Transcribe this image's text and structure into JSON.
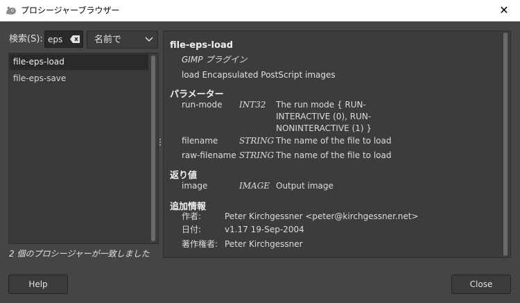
{
  "window": {
    "title": "プロシージャーブラウザー",
    "icon": "gimp-wilber-icon",
    "close_glyph": "✕"
  },
  "search": {
    "label": "検索(S):",
    "value": "eps",
    "match_mode": "名前で"
  },
  "procedures": [
    {
      "name": "file-eps-load",
      "selected": true
    },
    {
      "name": "file-eps-save",
      "selected": false
    }
  ],
  "match_count": "2 個のプロシージャーが一致しました",
  "details": {
    "name": "file-eps-load",
    "type": "GIMP プラグイン",
    "blurb": "load Encapsulated PostScript images",
    "params_heading": "パラメーター",
    "params": [
      {
        "name": "run-mode",
        "type": "INT32",
        "desc": "The run mode { RUN-INTERACTIVE (0), RUN-NONINTERACTIVE (1) }"
      },
      {
        "name": "filename",
        "type": "STRING",
        "desc": "The name of the file to load"
      },
      {
        "name": "raw-filename",
        "type": "STRING",
        "desc": "The name of the file to load"
      }
    ],
    "returns_heading": "返り値",
    "returns": [
      {
        "name": "image",
        "type": "IMAGE",
        "desc": "Output image"
      }
    ],
    "info_heading": "追加情報",
    "info": [
      {
        "label": "作者:",
        "value": "Peter Kirchgessner <peter@kirchgessner.net>"
      },
      {
        "label": "日付:",
        "value": "v1.17  19-Sep-2004"
      },
      {
        "label": "著作権者:",
        "value": "Peter Kirchgessner"
      }
    ]
  },
  "buttons": {
    "help": "Help",
    "close": "Close"
  },
  "colors": {
    "background": "#454545",
    "panel": "#3c3c3c",
    "selected_row": "#2a2a2a"
  }
}
